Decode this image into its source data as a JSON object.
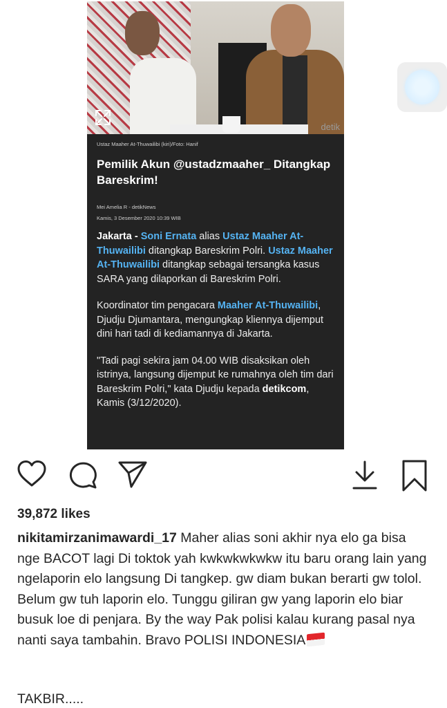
{
  "post": {
    "image": {
      "caption": "Ustaz Maaher At-Thuwailibi (kiri)/Foto: Hanif",
      "watermark": "detik",
      "headline": "Pemilik Akun @ustadzmaaher_ Ditangkap Bareskrim!",
      "author": "Mei Amelia R - detikNews",
      "date": "Kamis, 3 Desember 2020 10:39 WIB",
      "p1": {
        "city": "Jakarta - ",
        "link1": "Soni Ernata",
        "t1": " alias ",
        "link2": "Ustaz Maaher At-Thuwailibi",
        "t2": " ditangkap Bareskrim Polri. ",
        "link3": "Ustaz Maaher At-Thuwailibi",
        "t3": " ditangkap sebagai tersangka kasus SARA yang dilaporkan di Bareskrim Polri."
      },
      "p2": {
        "t1": "Koordinator tim pengacara ",
        "link1": "Maaher At-Thuwailibi",
        "t2": ", Djudju Djumantara, mengungkap kliennya dijemput dini hari tadi di kediamannya di Jakarta."
      },
      "p3": {
        "t1": "\"Tadi pagi sekira jam 04.00 WIB disaksikan oleh istrinya, langsung dijemput ke rumahnya oleh tim dari Bareskrim Polri,\" kata Djudju kepada ",
        "bold1": "detikcom",
        "t2": ", Kamis (3/12/2020)."
      }
    },
    "likes": "39,872 likes",
    "username": "nikitamirzanimawardi_17",
    "caption": " Maher alias soni akhir nya elo ga bisa nge BACOT lagi Di toktok yah kwkwkwkwkw itu baru orang lain yang ngelaporin elo langsung Di tangkep. gw diam bukan berarti gw tolol. Belum gw tuh laporin elo. Tunggu giliran gw yang laporin elo biar busuk loe di penjara. By the way Pak polisi kalau kurang pasal nya nanti saya tambahin. Bravo POLISI INDONESIA",
    "caption_end": "TAKBIR.....",
    "icons": {
      "like": "heart-icon",
      "comment": "comment-icon",
      "share": "send-icon",
      "download": "download-icon",
      "save": "bookmark-icon",
      "expand": "expand-icon"
    }
  }
}
